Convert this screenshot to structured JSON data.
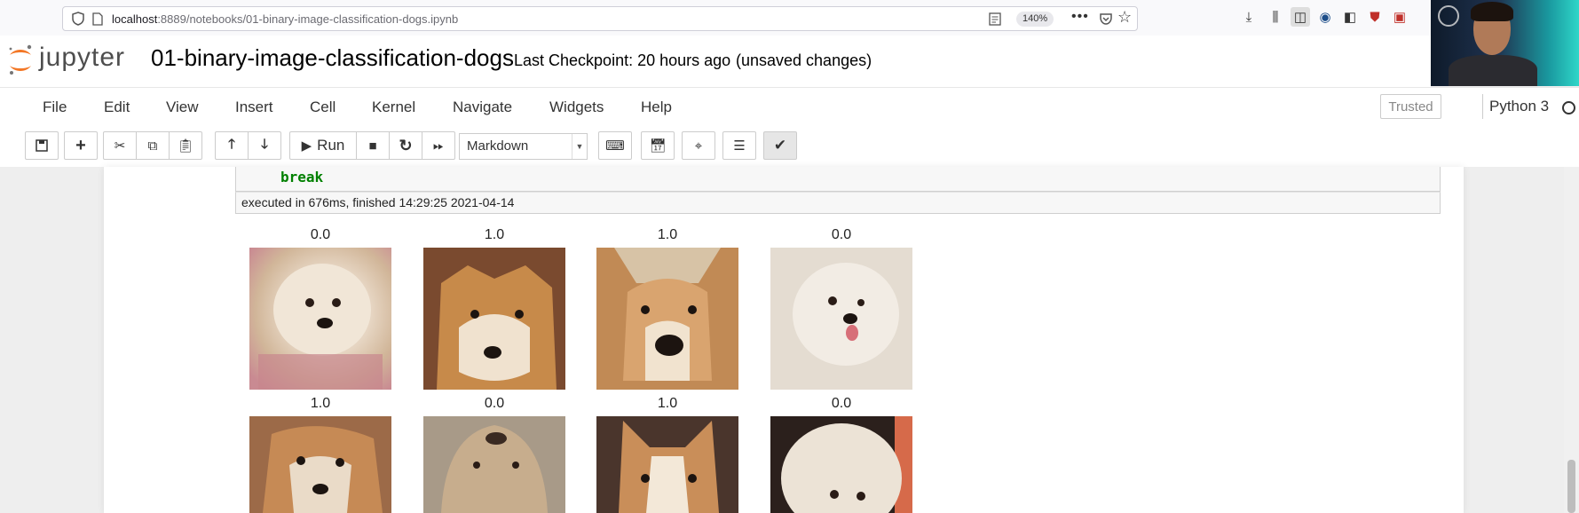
{
  "browser": {
    "url_host": "localhost",
    "url_path": ":8889/notebooks/01-binary-image-classification-dogs.ipynb",
    "zoom": "140%",
    "toolbar_icons": [
      "download-icon",
      "library-icon",
      "sidebar-icon",
      "globe-extension-icon",
      "extension-icon",
      "ublock-icon",
      "container-icon"
    ]
  },
  "jupyter": {
    "logo_text": "jupyter",
    "notebook_name": "01-binary-image-classification-dogs",
    "checkpoint": "Last Checkpoint: 20 hours ago",
    "status": "(unsaved changes)",
    "menu": [
      "File",
      "Edit",
      "View",
      "Insert",
      "Cell",
      "Kernel",
      "Navigate",
      "Widgets",
      "Help"
    ],
    "trusted": "Trusted",
    "kernel": "Python 3",
    "toolbar": {
      "run_label": "Run",
      "cell_type": "Markdown"
    }
  },
  "cell": {
    "code_keyword": "break",
    "exec_info": "executed in 676ms, finished 14:29:25 2021-04-14"
  },
  "output": {
    "labels": [
      "0.0",
      "1.0",
      "1.0",
      "0.0",
      "1.0",
      "0.0",
      "1.0",
      "0.0"
    ],
    "colors": {
      "fluffy_white": "#e9ddd0",
      "shiba_orange": "#c78a4a",
      "background_pink": "#c98a92",
      "background_dark": "#3b2b26"
    }
  }
}
